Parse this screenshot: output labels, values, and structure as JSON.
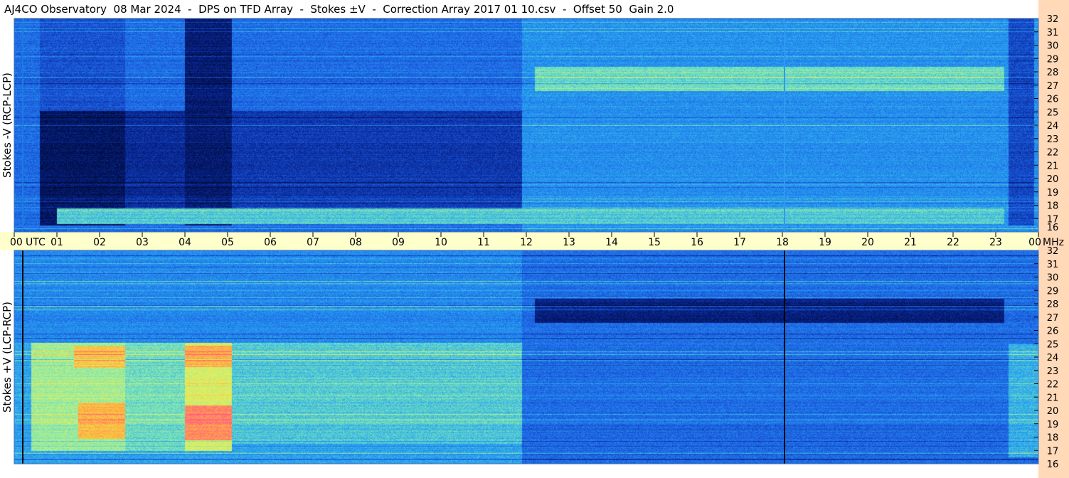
{
  "window": {
    "title": "AJ4CO Observatory  08 Mar 2024  -  DPS on TFD Array  -  Stokes ±V  -  Correction Array 2017 01 10.csv  -  Offset 50  Gain 2.0"
  },
  "chart_data": {
    "type": "heatmap",
    "title": "AJ4CO Observatory  08 Mar 2024  -  DPS on TFD Array  -  Stokes ±V  -  Correction Array 2017 01 10.csv  -  Offset 50  Gain 2.0",
    "x_tick_labels": [
      "00",
      "01",
      "02",
      "03",
      "04",
      "05",
      "06",
      "07",
      "08",
      "09",
      "10",
      "11",
      "12",
      "13",
      "14",
      "15",
      "16",
      "17",
      "18",
      "19",
      "20",
      "21",
      "22",
      "23",
      "00"
    ],
    "x_unit_label": "UTC",
    "xlim": [
      0,
      24
    ],
    "y_unit_label": "MHz",
    "ylim": [
      16,
      32
    ],
    "y_tick_labels": [
      "32",
      "31",
      "30",
      "29",
      "28",
      "27",
      "26",
      "25",
      "24",
      "23",
      "22",
      "21",
      "20",
      "19",
      "18",
      "17",
      "16"
    ],
    "grid": false,
    "panels": [
      {
        "ylabel": "Stokes -V (RCP-LCP)",
        "features": [
          {
            "t0": 0.6,
            "t1": 2.6,
            "f0": 16.5,
            "f1": 25.1,
            "level": 0.06
          },
          {
            "t0": 2.6,
            "t1": 4.0,
            "f0": 17.0,
            "f1": 25.1,
            "level": 0.14
          },
          {
            "t0": 4.0,
            "t1": 5.1,
            "f0": 16.5,
            "f1": 32.0,
            "level": 0.08
          },
          {
            "t0": 5.1,
            "t1": 11.9,
            "f0": 17.5,
            "f1": 25.1,
            "level": 0.18
          },
          {
            "t0": 0.6,
            "t1": 2.6,
            "f0": 25.1,
            "f1": 32.0,
            "level": 0.24
          },
          {
            "t0": 23.3,
            "t1": 23.9,
            "f0": 16.5,
            "f1": 32.0,
            "level": 0.22
          },
          {
            "t0": 12.2,
            "t1": 23.2,
            "f0": 26.6,
            "f1": 28.4,
            "level": 0.55
          },
          {
            "t0": 1.0,
            "t1": 23.2,
            "f0": 16.6,
            "f1": 17.8,
            "level": 0.5
          }
        ]
      },
      {
        "ylabel": "Stokes +V (LCP-RCP)",
        "features": [
          {
            "t0": 0.4,
            "t1": 2.6,
            "f0": 17.0,
            "f1": 25.1,
            "level": 0.62
          },
          {
            "t0": 1.4,
            "t1": 2.6,
            "f0": 23.2,
            "f1": 24.8,
            "level": 0.82
          },
          {
            "t0": 1.5,
            "t1": 2.6,
            "f0": 17.9,
            "f1": 20.6,
            "level": 0.85
          },
          {
            "t0": 2.6,
            "t1": 4.0,
            "f0": 17.0,
            "f1": 25.1,
            "level": 0.55
          },
          {
            "t0": 4.0,
            "t1": 5.1,
            "f0": 17.0,
            "f1": 25.1,
            "level": 0.7
          },
          {
            "t0": 4.0,
            "t1": 5.1,
            "f0": 23.3,
            "f1": 24.9,
            "level": 0.86
          },
          {
            "t0": 4.0,
            "t1": 5.1,
            "f0": 17.8,
            "f1": 20.4,
            "level": 0.93
          },
          {
            "t0": 5.1,
            "t1": 11.9,
            "f0": 17.5,
            "f1": 25.1,
            "level": 0.5
          },
          {
            "t0": 23.3,
            "t1": 24.0,
            "f0": 16.5,
            "f1": 25.0,
            "level": 0.45
          },
          {
            "t0": 12.2,
            "t1": 23.2,
            "f0": 26.6,
            "f1": 28.4,
            "level": 0.1
          }
        ]
      }
    ],
    "markers": [
      {
        "time": 0.2,
        "color": "#1a7de0"
      },
      {
        "time": 18.05,
        "color": "#2f9aee"
      }
    ],
    "colormap": [
      "#000a3a",
      "#0a2a9c",
      "#1e64e6",
      "#29a8f0",
      "#7fe7b5",
      "#e4f25c",
      "#ffb43a",
      "#ff5a8a"
    ]
  }
}
